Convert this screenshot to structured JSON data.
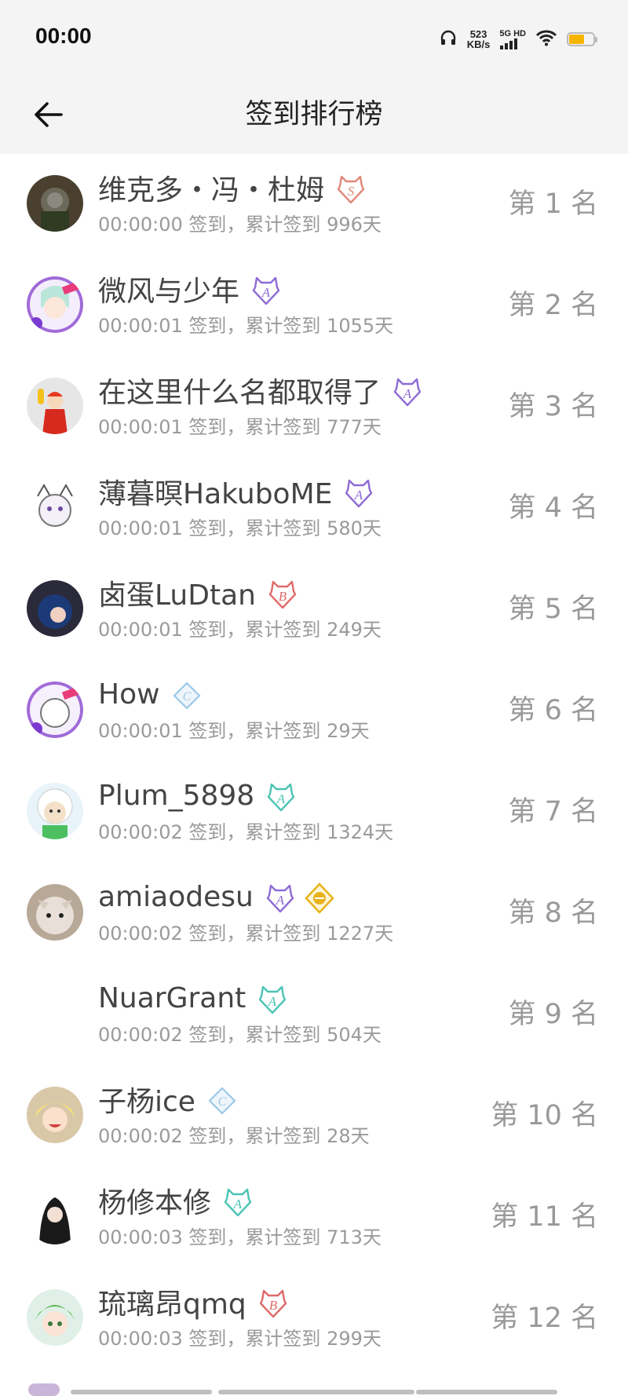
{
  "status_bar": {
    "time": "00:00",
    "speed_value": "523",
    "speed_unit": "KB/s",
    "network": "5G HD",
    "battery_level": 0.6
  },
  "header": {
    "title": "签到排行榜"
  },
  "colors": {
    "badge_S": "#e0887a",
    "badge_A_purple": "#8e6bd6",
    "badge_B": "#e06a6a",
    "badge_C": "#9cc8e8",
    "badge_A_teal": "#4cc4b4",
    "badge_gold": "#e8b21a"
  },
  "rows": [
    {
      "name": "维克多・冯・杜姆",
      "time": "00:00:00",
      "sep": " 签到，累计签到 ",
      "days": "996天",
      "rank": "第 1 名",
      "badges": [
        "S"
      ],
      "avatar": "dark-mask"
    },
    {
      "name": "微风与少年",
      "time": "00:00:01",
      "sep": " 签到，累计签到 ",
      "days": "1055天",
      "rank": "第 2 名",
      "badges": [
        "A-purple"
      ],
      "avatar": "anime-green"
    },
    {
      "name": "在这里什么名都取得了",
      "time": "00:00:01",
      "sep": " 签到，累计签到 ",
      "days": "777天",
      "rank": "第 3 名",
      "badges": [
        "A-purple"
      ],
      "avatar": "clown"
    },
    {
      "name": "薄暮暝HakuboME",
      "time": "00:00:01",
      "sep": " 签到，累计签到 ",
      "days": "580天",
      "rank": "第 4 名",
      "badges": [
        "A-purple"
      ],
      "avatar": "sketch-cat"
    },
    {
      "name": "卤蛋LuDtan",
      "time": "00:00:01",
      "sep": " 签到，累计签到 ",
      "days": "249天",
      "rank": "第 5 名",
      "badges": [
        "B"
      ],
      "avatar": "blue-hair"
    },
    {
      "name": "How",
      "time": "00:00:01",
      "sep": " 签到，累计签到 ",
      "days": "29天",
      "rank": "第 6 名",
      "badges": [
        "C"
      ],
      "avatar": "sketch-cat-frame"
    },
    {
      "name": "Plum_5898",
      "time": "00:00:02",
      "sep": " 签到，累计签到 ",
      "days": "1324天",
      "rank": "第 7 名",
      "badges": [
        "A-teal"
      ],
      "avatar": "sheep"
    },
    {
      "name": "amiaodesu",
      "time": "00:00:02",
      "sep": " 签到，累计签到 ",
      "days": "1227天",
      "rank": "第 8 名",
      "badges": [
        "A-purple",
        "gold"
      ],
      "avatar": "cat-photo"
    },
    {
      "name": "NuarGrant",
      "time": "00:00:02",
      "sep": " 签到，累计签到 ",
      "days": "504天",
      "rank": "第 9 名",
      "badges": [
        "A-teal"
      ],
      "avatar": "none"
    },
    {
      "name": "子杨ice",
      "time": "00:00:02",
      "sep": " 签到，累计签到 ",
      "days": "28天",
      "rank": "第 10 名",
      "badges": [
        "C"
      ],
      "avatar": "blonde"
    },
    {
      "name": "杨修本修",
      "time": "00:00:03",
      "sep": " 签到，累计签到 ",
      "days": "713天",
      "rank": "第 11 名",
      "badges": [
        "A-teal"
      ],
      "avatar": "black-hair"
    },
    {
      "name": "琉璃昂qmq",
      "time": "00:00:03",
      "sep": " 签到，累计签到 ",
      "days": "299天",
      "rank": "第 12 名",
      "badges": [
        "B"
      ],
      "avatar": "green-hair"
    }
  ]
}
